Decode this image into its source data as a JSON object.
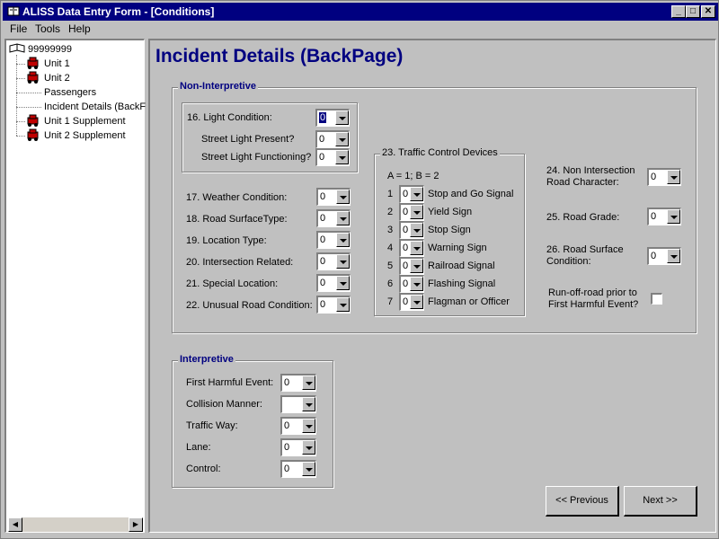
{
  "window": {
    "title": "ALISS Data Entry Form - [Conditions]"
  },
  "menu": {
    "file": "File",
    "tools": "Tools",
    "help": "Help"
  },
  "tree": {
    "root": "99999999",
    "items": [
      {
        "label": "Unit 1",
        "icon": "car-icon"
      },
      {
        "label": "Unit 2",
        "icon": "car-icon"
      },
      {
        "label": "Passengers",
        "icon": ""
      },
      {
        "label": "Incident Details (BackF",
        "icon": ""
      },
      {
        "label": "Unit 1 Supplement",
        "icon": "car-icon"
      },
      {
        "label": "Unit 2 Supplement",
        "icon": "car-icon"
      }
    ]
  },
  "page": {
    "title": "Incident Details (BackPage)"
  },
  "non_interpretive": {
    "label": "Non-Interpretive",
    "light": {
      "label": "16. Light Condition:",
      "value": "0",
      "street_light_present_label": "Street Light Present?",
      "street_light_present_value": "0",
      "street_light_functioning_label": "Street Light Functioning?",
      "street_light_functioning_value": "0"
    },
    "fields": [
      {
        "label": "17. Weather Condition:",
        "value": "0"
      },
      {
        "label": "18. Road SurfaceType:",
        "value": "0"
      },
      {
        "label": "19. Location Type:",
        "value": "0"
      },
      {
        "label": "20. Intersection Related:",
        "value": "0"
      },
      {
        "label": "21. Special Location:",
        "value": "0"
      },
      {
        "label": "22. Unusual Road Condition:",
        "value": "0"
      }
    ],
    "traffic_control": {
      "label": "23. Traffic Control Devices",
      "legend": "A = 1; B = 2",
      "items": [
        {
          "num": "1",
          "value": "0",
          "label": "Stop and Go Signal"
        },
        {
          "num": "2",
          "value": "0",
          "label": "Yield Sign"
        },
        {
          "num": "3",
          "value": "0",
          "label": "Stop Sign"
        },
        {
          "num": "4",
          "value": "0",
          "label": "Warning Sign"
        },
        {
          "num": "5",
          "value": "0",
          "label": "Railroad Signal"
        },
        {
          "num": "6",
          "value": "0",
          "label": "Flashing Signal"
        },
        {
          "num": "7",
          "value": "0",
          "label": "Flagman or Officer"
        }
      ]
    },
    "non_intersection": {
      "label_line1": "24. Non Intersection",
      "label_line2": "Road Character:",
      "value": "0"
    },
    "road_grade": {
      "label": "25. Road Grade:",
      "value": "0"
    },
    "road_surface_condition": {
      "label_line1": "26. Road Surface",
      "label_line2": "Condition:",
      "value": "0"
    },
    "run_off_road": {
      "label_line1": "Run-off-road prior to",
      "label_line2": "First Harmful Event?",
      "checked": false
    }
  },
  "interpretive": {
    "label": "Interpretive",
    "fields": [
      {
        "label": "First Harmful Event:",
        "value": "0"
      },
      {
        "label": "Collision Manner:",
        "value": ""
      },
      {
        "label": "Traffic Way:",
        "value": "0"
      },
      {
        "label": "Lane:",
        "value": "0"
      },
      {
        "label": "Control:",
        "value": "0"
      }
    ]
  },
  "buttons": {
    "previous": "<< Previous",
    "next": "Next >>"
  }
}
